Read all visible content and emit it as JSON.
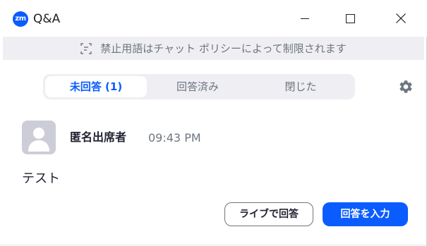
{
  "titlebar": {
    "app_icon_text": "zm",
    "title": "Q&A"
  },
  "banner": {
    "text": "禁止用語はチャット ポリシーによって制限されます"
  },
  "tabs": [
    {
      "label": "未回答 (1)",
      "active": true
    },
    {
      "label": "回答済み",
      "active": false
    },
    {
      "label": "閉じた",
      "active": false
    }
  ],
  "question": {
    "author": "匿名出席者",
    "time": "09:43 PM",
    "text": "テスト"
  },
  "actions": {
    "answer_live": "ライブで回答",
    "type_answer": "回答を入力"
  },
  "colors": {
    "accent": "#0b5cff",
    "banner_bg": "#efeff3",
    "muted_text": "#6e7680"
  }
}
